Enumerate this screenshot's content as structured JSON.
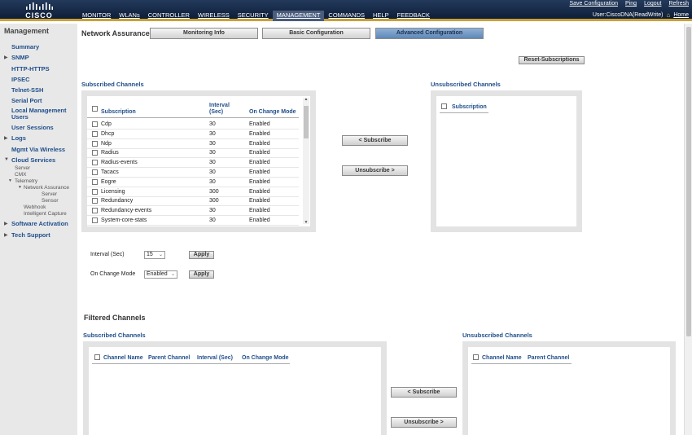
{
  "header": {
    "logo_text": "CISCO",
    "nav": [
      "MONITOR",
      "WLANs",
      "CONTROLLER",
      "WIRELESS",
      "SECURITY",
      "MANAGEMENT",
      "COMMANDS",
      "HELP",
      "FEEDBACK"
    ],
    "active_nav": "MANAGEMENT",
    "links": [
      "Save Configuration",
      "Ping",
      "Logout",
      "Refresh"
    ],
    "user": "User:CiscoDNA(ReadWrite)",
    "home": "Home"
  },
  "sidebar": {
    "title": "Management",
    "summary": "Summary",
    "snmp": "SNMP",
    "http": "HTTP-HTTPS",
    "ipsec": "IPSEC",
    "telnet": "Telnet-SSH",
    "serial": "Serial Port",
    "local_mgmt": "Local Management Users",
    "sessions": "User Sessions",
    "logs": "Logs",
    "mgmt_wireless": "Mgmt Via Wireless",
    "cloud": "Cloud Services",
    "server": "Server",
    "cmx": "CMX",
    "telemetry": "Telemetry",
    "network_assurance": "Network Assurance",
    "na_server": "Server",
    "na_sensor": "Sensor",
    "webhook": "Webhook",
    "intelligent": "Intelligent Capture",
    "software": "Software Activation",
    "tech": "Tech Support"
  },
  "main": {
    "page_title": "Network Assurance",
    "tabs": {
      "monitoring": "Monitoring Info",
      "basic": "Basic Configuration",
      "advanced": "Advanced Configuration"
    },
    "reset_button": "Reset-Subscriptions",
    "subscribed_title": "Subscribed Channels",
    "unsubscribed_title": "Unsubscribed Channels",
    "subscribed_columns": {
      "subscription": "Subscription",
      "interval": "Interval (Sec)",
      "on_change": "On Change Mode"
    },
    "subscriptions": [
      {
        "name": "Cdp",
        "interval": "30",
        "mode": "Enabled"
      },
      {
        "name": "Dhcp",
        "interval": "30",
        "mode": "Enabled"
      },
      {
        "name": "Ndp",
        "interval": "30",
        "mode": "Enabled"
      },
      {
        "name": "Radius",
        "interval": "30",
        "mode": "Enabled"
      },
      {
        "name": "Radius-events",
        "interval": "30",
        "mode": "Enabled"
      },
      {
        "name": "Tacacs",
        "interval": "30",
        "mode": "Enabled"
      },
      {
        "name": "Eogre",
        "interval": "30",
        "mode": "Enabled"
      },
      {
        "name": "Licensing",
        "interval": "300",
        "mode": "Enabled"
      },
      {
        "name": "Redundancy",
        "interval": "300",
        "mode": "Enabled"
      },
      {
        "name": "Redundancy-events",
        "interval": "30",
        "mode": "Enabled"
      },
      {
        "name": "System-core-stats",
        "interval": "30",
        "mode": "Enabled"
      }
    ],
    "unsubscribed_column": "Subscription",
    "subscribe_button": "< Subscribe",
    "unsubscribe_button": "Unsubscribe >",
    "interval_label": "Interval (Sec)",
    "interval_value": "15",
    "on_change_label": "On Change Mode",
    "on_change_value": "Enabled",
    "apply_label": "Apply",
    "filtered_title": "Filtered Channels",
    "filtered_sub_title": "Subscribed Channels",
    "filtered_unsub_title": "Unsubscribed Channels",
    "filtered_sub_columns": {
      "channel": "Channel Name",
      "parent": "Parent Channel",
      "interval": "Interval (Sec)",
      "on_change": "On Change Mode"
    },
    "filtered_unsub_columns": {
      "channel": "Channel Name",
      "parent": "Parent Channel"
    }
  }
}
